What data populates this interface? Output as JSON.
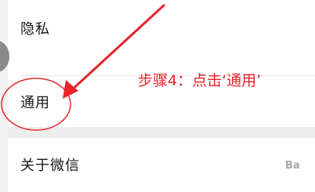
{
  "settings": {
    "items": [
      {
        "label": "隐私"
      },
      {
        "label": "通用"
      },
      {
        "label": "关于微信"
      }
    ]
  },
  "annotation": {
    "text": "步骤4：点击‘通用’",
    "color": "#e8242a"
  },
  "watermark": {
    "text": "Ba"
  }
}
